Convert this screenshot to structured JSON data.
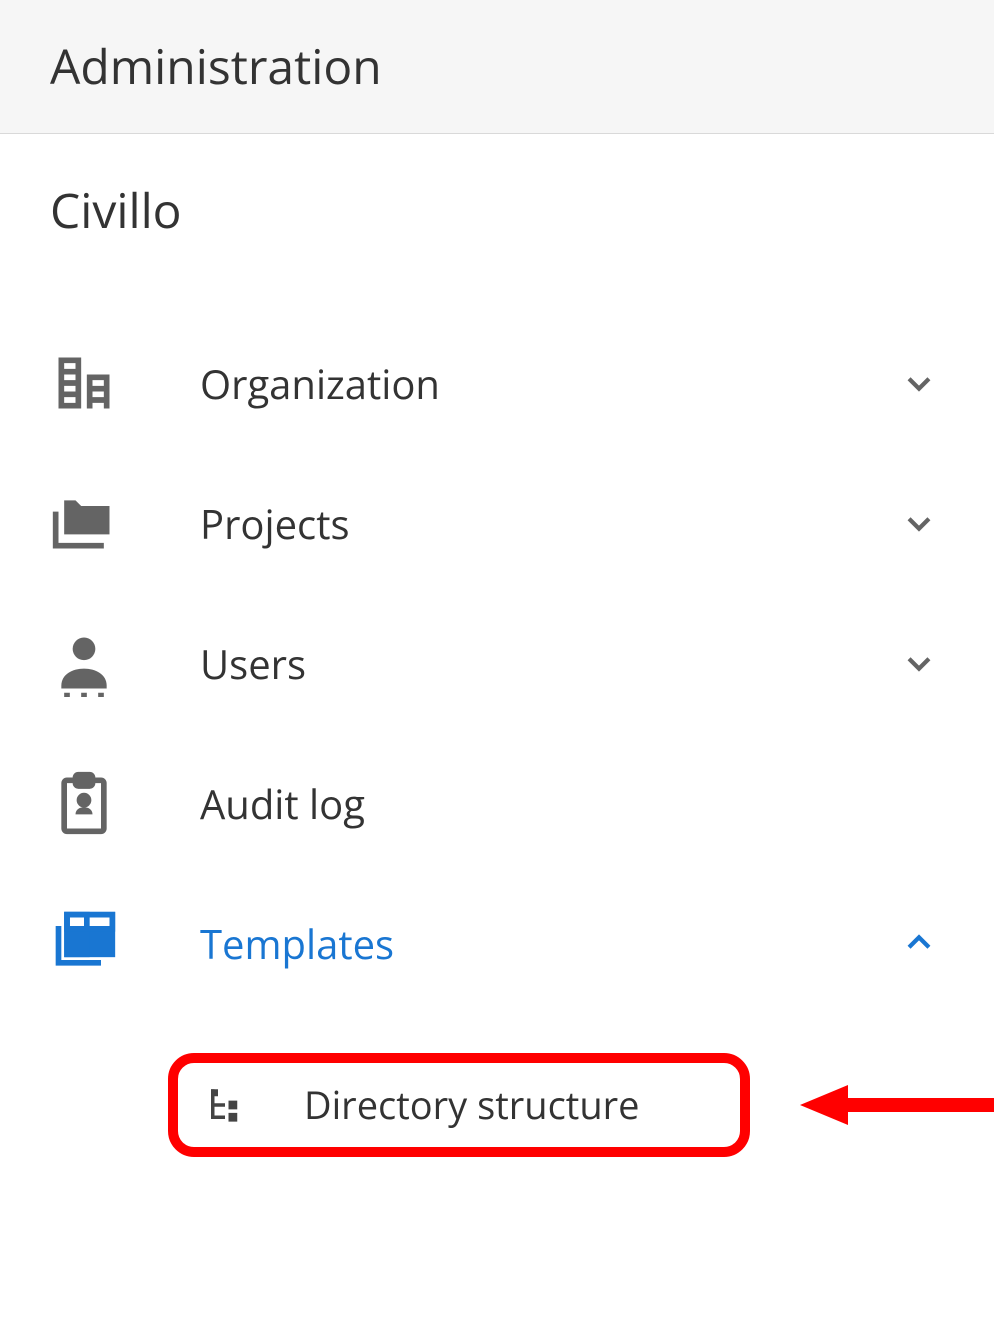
{
  "header": {
    "title": "Administration"
  },
  "organization": {
    "name": "Civillo"
  },
  "nav": {
    "items": [
      {
        "label": "Organization",
        "icon": "building",
        "expandable": true,
        "expanded": false,
        "active": false
      },
      {
        "label": "Projects",
        "icon": "folders",
        "expandable": true,
        "expanded": false,
        "active": false
      },
      {
        "label": "Users",
        "icon": "person",
        "expandable": true,
        "expanded": false,
        "active": false
      },
      {
        "label": "Audit log",
        "icon": "clipboard",
        "expandable": false,
        "expanded": false,
        "active": false
      },
      {
        "label": "Templates",
        "icon": "templates",
        "expandable": true,
        "expanded": true,
        "active": true
      }
    ]
  },
  "templates_submenu": {
    "items": [
      {
        "label": "Directory structure",
        "icon": "tree"
      }
    ]
  },
  "colors": {
    "accent": "#1976d2",
    "highlight": "#ff0000",
    "text": "#333333",
    "muted_icon": "#646464"
  }
}
